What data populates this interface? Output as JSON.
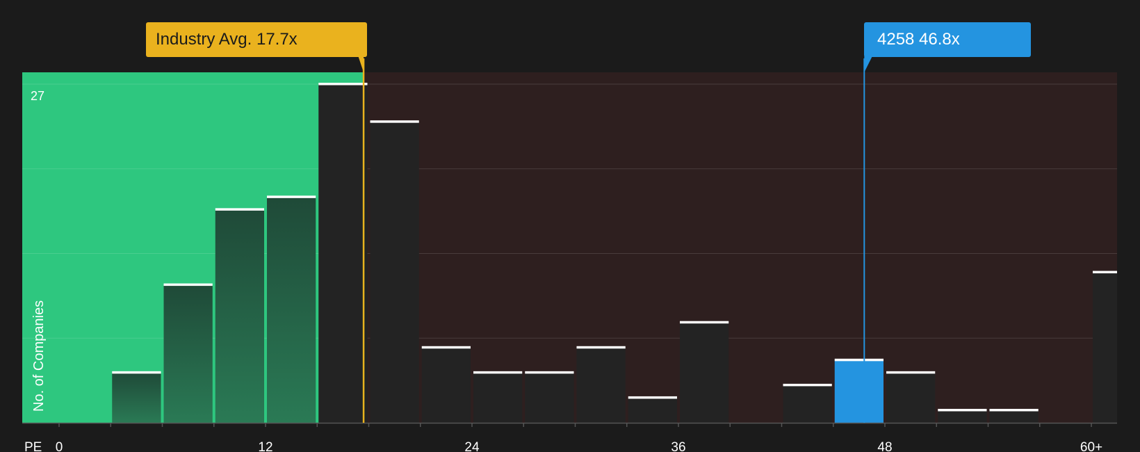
{
  "chart_data": {
    "type": "bar",
    "xaxis_prefix": "PE",
    "ylabel": "No. of Companies",
    "ymax_label": "27",
    "ylim": [
      0,
      27
    ],
    "x_ticks": [
      "0",
      "12",
      "24",
      "36",
      "48",
      "60+"
    ],
    "x_tick_values": [
      0,
      12,
      24,
      36,
      48,
      60
    ],
    "bins": [
      {
        "x0": 3,
        "x1": 6,
        "value": 4
      },
      {
        "x0": 6,
        "x1": 9,
        "value": 11
      },
      {
        "x0": 9,
        "x1": 12,
        "value": 17
      },
      {
        "x0": 12,
        "x1": 15,
        "value": 18
      },
      {
        "x0": 15,
        "x1": 18,
        "value": 27
      },
      {
        "x0": 18,
        "x1": 21,
        "value": 24
      },
      {
        "x0": 21,
        "x1": 24,
        "value": 6
      },
      {
        "x0": 24,
        "x1": 27,
        "value": 4
      },
      {
        "x0": 27,
        "x1": 30,
        "value": 4
      },
      {
        "x0": 30,
        "x1": 33,
        "value": 6
      },
      {
        "x0": 33,
        "x1": 36,
        "value": 2
      },
      {
        "x0": 36,
        "x1": 39,
        "value": 8
      },
      {
        "x0": 39,
        "x1": 42,
        "value": 0
      },
      {
        "x0": 42,
        "x1": 45,
        "value": 3
      },
      {
        "x0": 45,
        "x1": 48,
        "value": 5,
        "highlight": true
      },
      {
        "x0": 48,
        "x1": 51,
        "value": 4
      },
      {
        "x0": 51,
        "x1": 54,
        "value": 1
      },
      {
        "x0": 54,
        "x1": 57,
        "value": 1
      },
      {
        "x0": 57,
        "x1": 60,
        "value": 0
      },
      {
        "x0": 60,
        "x1": 61.6,
        "value": 12
      }
    ],
    "industry_avg": {
      "label": "Industry Avg. 17.7x",
      "value": 17.7
    },
    "company": {
      "label": "4258 46.8x",
      "value": 46.8
    },
    "colors": {
      "background": "#1b1b1b",
      "fair_region": "#2ec77f",
      "overvalued_region": "#2e1f1f",
      "bar": "#232323",
      "bar_on_green": "#1f4a38",
      "highlight_bar": "#2494e0",
      "industry": "#eab21e",
      "company": "#2494e0",
      "cap": "#ffffff"
    }
  }
}
